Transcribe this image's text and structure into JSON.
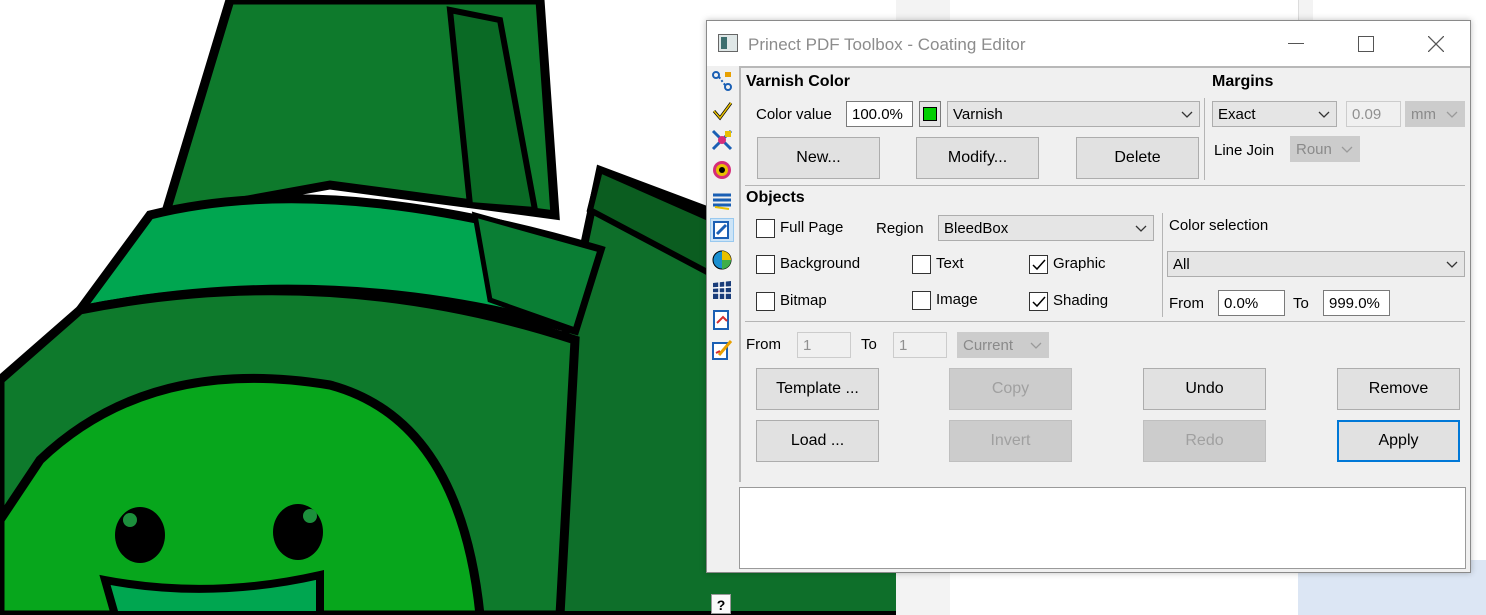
{
  "window": {
    "title": "Prinect PDF Toolbox - Coating Editor",
    "controls": [
      "minimize",
      "maximize",
      "close"
    ]
  },
  "toolbar_icons": [
    "workflow-icon",
    "check-icon",
    "color-convert-icon",
    "color-wheel-icon",
    "layers-icon",
    "coating-icon",
    "color-mix-icon",
    "grid-icon",
    "pdf-edit-icon",
    "pdf-brush-icon"
  ],
  "varnish": {
    "header": "Varnish Color",
    "color_value_label": "Color value",
    "color_value": "100.0%",
    "swatch_color": "#00d000",
    "varnish_select": "Varnish",
    "new_label": "New...",
    "modify_label": "Modify...",
    "delete_label": "Delete"
  },
  "margins": {
    "header": "Margins",
    "mode_select": "Exact",
    "value": "0.09",
    "unit": "mm",
    "line_join_label": "Line Join",
    "line_join_select": "Roun"
  },
  "objects": {
    "header": "Objects",
    "full_page_label": "Full Page",
    "full_page_checked": false,
    "region_label": "Region",
    "region_select": "BleedBox",
    "background_label": "Background",
    "background_checked": false,
    "text_label": "Text",
    "text_checked": false,
    "graphic_label": "Graphic",
    "graphic_checked": true,
    "bitmap_label": "Bitmap",
    "bitmap_checked": false,
    "image_label": "Image",
    "image_checked": false,
    "shading_label": "Shading",
    "shading_checked": true
  },
  "color_selection": {
    "label": "Color selection",
    "select": "All",
    "from_label": "From",
    "from_value": "0.0%",
    "to_label": "To",
    "to_value": "999.0%"
  },
  "pages": {
    "from_label": "From",
    "from_value": "1",
    "to_label": "To",
    "to_value": "1",
    "range_select": "Current"
  },
  "actions": {
    "template_label": "Template ...",
    "copy_label": "Copy",
    "undo_label": "Undo",
    "remove_label": "Remove",
    "load_label": "Load ...",
    "invert_label": "Invert",
    "redo_label": "Redo",
    "apply_label": "Apply"
  },
  "help_label": "?",
  "colors": {
    "accent": "#0078d7",
    "dialog_bg": "#f0f0f0",
    "mascot_dark": "#0e7a2c",
    "mascot_light": "#00a650",
    "mascot_face": "#07a61c"
  }
}
